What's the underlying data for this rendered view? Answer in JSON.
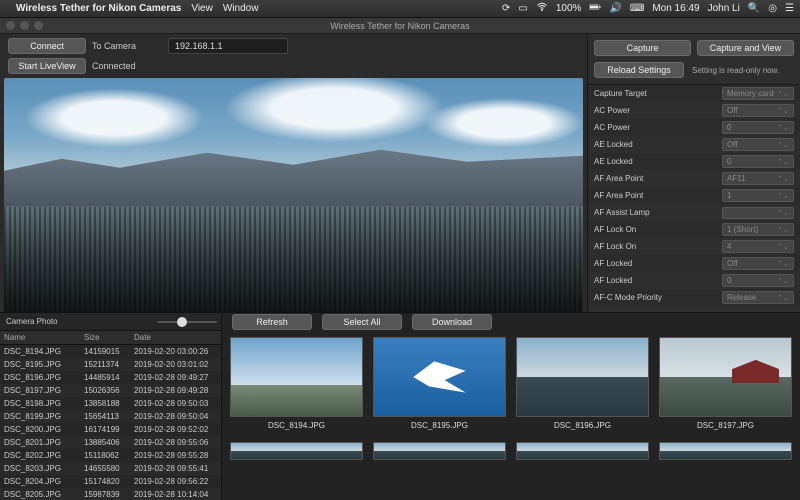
{
  "menubar": {
    "app_title": "Wireless Tether for Nikon Cameras",
    "menus": [
      "View",
      "Window"
    ],
    "battery": "100%",
    "clock": "Mon 16:49",
    "user": "John Li"
  },
  "window": {
    "title": "Wireless Tether for Nikon Cameras"
  },
  "connect": {
    "connect_btn": "Connect",
    "to_camera_label": "To Camera",
    "ip_value": "192.168.1.1",
    "liveview_btn": "Start LiveView",
    "status": "Connected"
  },
  "capture": {
    "capture_btn": "Capture",
    "capture_view_btn": "Capture and View",
    "reload_btn": "Reload Settings",
    "readonly_text": "Setting is read-only now."
  },
  "settings": [
    {
      "name": "Capture Target",
      "value": "Memory card"
    },
    {
      "name": "AC Power",
      "value": "Off"
    },
    {
      "name": "AC Power",
      "value": "0"
    },
    {
      "name": "AE Locked",
      "value": "Off"
    },
    {
      "name": "AE Locked",
      "value": "0"
    },
    {
      "name": "AF Area Point",
      "value": "AF11"
    },
    {
      "name": "AF Area Point",
      "value": "1"
    },
    {
      "name": "AF Assist Lamp",
      "value": ""
    },
    {
      "name": "AF Lock On",
      "value": "1 (Short)"
    },
    {
      "name": "AF Lock On",
      "value": "4"
    },
    {
      "name": "AF Locked",
      "value": "Off"
    },
    {
      "name": "AF Locked",
      "value": "0"
    },
    {
      "name": "AF-C Mode Priority",
      "value": "Release"
    }
  ],
  "photolist": {
    "title": "Camera Photo",
    "cols": {
      "name": "Name",
      "size": "Size",
      "date": "Date"
    },
    "rows": [
      {
        "name": "DSC_8194.JPG",
        "size": "14159015",
        "date": "2019-02-20 03:00:26"
      },
      {
        "name": "DSC_8195.JPG",
        "size": "15211374",
        "date": "2019-02-20 03:01:02"
      },
      {
        "name": "DSC_8196.JPG",
        "size": "14485914",
        "date": "2019-02-28 09:49:27"
      },
      {
        "name": "DSC_8197.JPG",
        "size": "15026356",
        "date": "2019-02-28 09:49:28"
      },
      {
        "name": "DSC_8198.JPG",
        "size": "13858188",
        "date": "2019-02-28 09:50:03"
      },
      {
        "name": "DSC_8199.JPG",
        "size": "15654113",
        "date": "2019-02-28 09:50:04"
      },
      {
        "name": "DSC_8200.JPG",
        "size": "16174199",
        "date": "2019-02-28 09:52:02"
      },
      {
        "name": "DSC_8201.JPG",
        "size": "13885406",
        "date": "2019-02-28 09:55:06"
      },
      {
        "name": "DSC_8202.JPG",
        "size": "15118062",
        "date": "2019-02-28 09:55:28"
      },
      {
        "name": "DSC_8203.JPG",
        "size": "14655580",
        "date": "2019-02-28 09:55:41"
      },
      {
        "name": "DSC_8204.JPG",
        "size": "15174820",
        "date": "2019-02-28 09:56:22"
      },
      {
        "name": "DSC_8205.JPG",
        "size": "15987839",
        "date": "2019-02-28 10:14:04"
      }
    ]
  },
  "gallerybar": {
    "refresh": "Refresh",
    "selectall": "Select All",
    "download": "Download"
  },
  "thumbs": [
    {
      "name": "DSC_8194.JPG",
      "style": "tsky"
    },
    {
      "name": "DSC_8195.JPG",
      "style": "tbird"
    },
    {
      "name": "DSC_8196.JPG",
      "style": "tlake"
    },
    {
      "name": "DSC_8197.JPG",
      "style": "tpav"
    }
  ]
}
